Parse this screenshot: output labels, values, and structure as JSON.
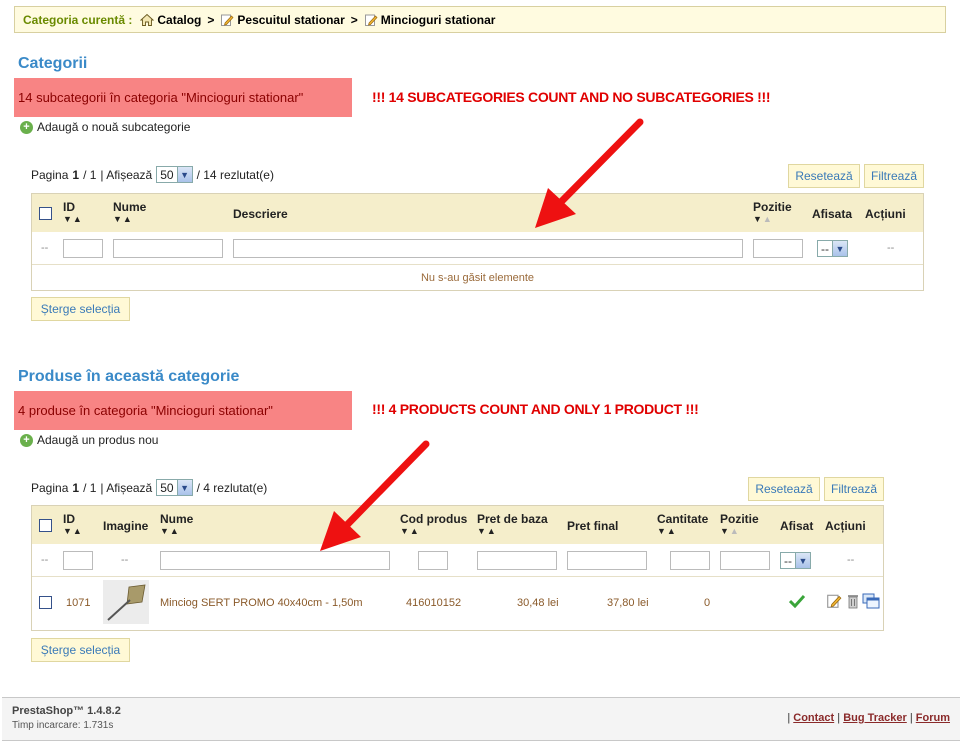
{
  "breadcrumb": {
    "label": "Categoria curentă :",
    "items": [
      "Catalog",
      "Pescuitul stationar",
      "Mincioguri stationar"
    ],
    "separator": ">"
  },
  "categories": {
    "title": "Categorii",
    "count_text": "14 subcategorii în categoria \"Mincioguri stationar\"",
    "annotation": "!!! 14 SUBCATEGORIES COUNT AND NO SUBCATEGORIES !!!",
    "add_label": "Adaugă o nouă subcategorie",
    "pager": {
      "page_label": "Pagina",
      "page": "1",
      "total_pages": "/ 1",
      "show_label": "| Afișează",
      "per_page": "50",
      "results": "/ 14 rezlutat(e)"
    },
    "reset_label": "Resetează",
    "filter_label": "Filtrează",
    "columns": {
      "id": "ID",
      "name": "Nume",
      "description": "Descriere",
      "position": "Pozitie",
      "displayed": "Afisata",
      "actions": "Acțiuni"
    },
    "filter_dash": "--",
    "select_value": "--",
    "empty_text": "Nu s-au găsit elemente",
    "delete_label": "Șterge selecția"
  },
  "products": {
    "title": "Produse în această categorie",
    "count_text": "4 produse în categoria \"Mincioguri stationar\"",
    "annotation": "!!! 4 PRODUCTS COUNT AND ONLY 1 PRODUCT !!!",
    "add_label": "Adaugă un produs nou",
    "pager": {
      "page_label": "Pagina",
      "page": "1",
      "total_pages": "/ 1",
      "show_label": "| Afișează",
      "per_page": "50",
      "results": "/ 4 rezlutat(e)"
    },
    "reset_label": "Resetează",
    "filter_label": "Filtrează",
    "columns": {
      "id": "ID",
      "image": "Imagine",
      "name": "Nume",
      "code": "Cod produs",
      "base_price": "Pret de baza",
      "final_price": "Pret final",
      "quantity": "Cantitate",
      "position": "Pozitie",
      "displayed": "Afisat",
      "actions": "Acțiuni"
    },
    "filter_dash": "--",
    "select_value": "--",
    "rows": [
      {
        "id": "1071",
        "name": "Minciog SERT PROMO 40x40cm - 1,50m",
        "code": "416010152",
        "base_price": "30,48 lei",
        "final_price": "37,80 lei",
        "quantity": "0"
      }
    ],
    "delete_label": "Șterge selecția"
  },
  "footer": {
    "version": "PrestaShop™ 1.4.8.2",
    "load_time": "Timp incarcare: 1.731s",
    "links": [
      "Contact",
      "Bug Tracker",
      "Forum"
    ]
  }
}
